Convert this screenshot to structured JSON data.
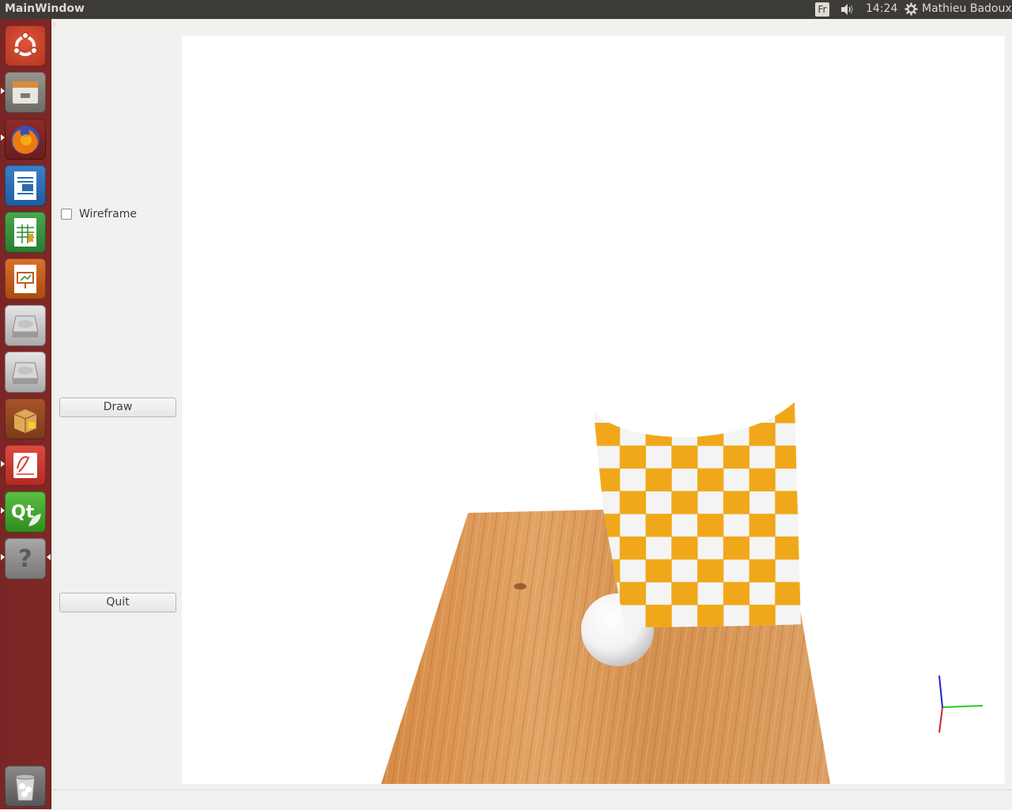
{
  "top_panel": {
    "window_title": "MainWindow",
    "keyboard_layout": "Fr",
    "time": "14:24",
    "user_name": "Mathieu Badoux",
    "icons": [
      "keyboard-layout-icon",
      "volume-icon",
      "settings-gear-icon"
    ]
  },
  "launcher": {
    "items": [
      {
        "name": "ubuntu-dash-icon",
        "color": "#c7442b",
        "running": false
      },
      {
        "name": "files-icon",
        "color": "#7d7a74",
        "running": true
      },
      {
        "name": "firefox-icon",
        "color": "#e66000",
        "running": true
      },
      {
        "name": "libreoffice-writer-icon",
        "color": "#2a6bb0",
        "running": false
      },
      {
        "name": "libreoffice-calc-icon",
        "color": "#2e8b36",
        "running": false
      },
      {
        "name": "libreoffice-impress-icon",
        "color": "#c25a1a",
        "running": false
      },
      {
        "name": "drive-icon",
        "color": "#c8c8c8",
        "running": false
      },
      {
        "name": "drive-icon",
        "color": "#c8c8c8",
        "running": false
      },
      {
        "name": "software-center-icon",
        "color": "#c58a3a",
        "running": false
      },
      {
        "name": "document-viewer-icon",
        "color": "#d43a2f",
        "running": true
      },
      {
        "name": "qt-creator-icon",
        "color": "#41a02b",
        "running": true
      },
      {
        "name": "unknown-app-icon",
        "color": "#8c8c8c",
        "running": true
      },
      {
        "name": "trash-icon",
        "color": "#9a9a9a",
        "running": false
      }
    ],
    "qt_label": "Qt",
    "unknown_label": "?"
  },
  "controls": {
    "wireframe_label": "Wireframe",
    "wireframe_checked": false,
    "draw_label": "Draw",
    "quit_label": "Quit"
  },
  "scene": {
    "background": "#ffffff",
    "objects": [
      "wooden-plank-floor",
      "checkered-cloth",
      "sphere",
      "axis-gizmo"
    ],
    "cloth_colors": {
      "orange": "#f0a81a",
      "white": "#f4f4f4"
    },
    "wood_color": "#d9944e",
    "axis_colors": {
      "x": "#22cc22",
      "y": "#2222cc",
      "z": "#cc2222"
    }
  }
}
